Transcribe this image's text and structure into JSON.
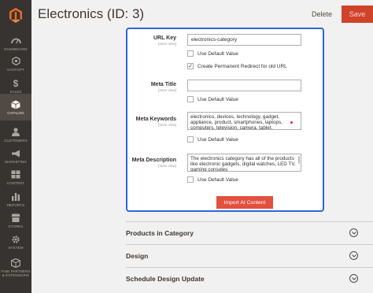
{
  "sidebar": {
    "items": [
      {
        "label": "Dashboard",
        "icon": "dashboard-icon"
      },
      {
        "label": "Chatgpt",
        "icon": "chatgpt-icon"
      },
      {
        "label": "Sales",
        "icon": "dollar-icon"
      },
      {
        "label": "Catalog",
        "icon": "catalog-icon"
      },
      {
        "label": "Customers",
        "icon": "customers-icon"
      },
      {
        "label": "Marketing",
        "icon": "megaphone-icon"
      },
      {
        "label": "Content",
        "icon": "content-icon"
      },
      {
        "label": "Reports",
        "icon": "bar-chart-icon"
      },
      {
        "label": "Stores",
        "icon": "stores-icon"
      },
      {
        "label": "System",
        "icon": "gear-icon"
      },
      {
        "label": "Find Partners & Extensions",
        "icon": "cube-icon"
      }
    ],
    "active_index": 3
  },
  "header": {
    "title": "Electronics (ID: 3)",
    "delete_label": "Delete",
    "save_label": "Save"
  },
  "form": {
    "store_view": "[store view]",
    "url_key": {
      "label": "URL Key",
      "value": "electronics-category",
      "use_default": "Use Default Value",
      "redirect": "Create Permanent Redirect for old URL"
    },
    "meta_title": {
      "label": "Meta Title",
      "value": "",
      "use_default": "Use Default Value"
    },
    "meta_keywords": {
      "label": "Meta Keywords",
      "value": "electronics, devices, technology, gadget, appliance, product, smartphones, laptops, computers, television, camera, tablet,",
      "use_default": "Use Default Value"
    },
    "meta_description": {
      "label": "Meta Description",
      "value": "The electronics category has all of the products like electronic gadgets, digital watches, LED TV, gaming consoles",
      "use_default": "Use Default Value"
    },
    "import_label": "Import AI Content"
  },
  "sections": [
    {
      "title": "Products in Category"
    },
    {
      "title": "Design"
    },
    {
      "title": "Schedule Design Update"
    }
  ],
  "colors": {
    "sidebar_bg": "#373330",
    "sidebar_active": "#514943",
    "save_bg": "#d0432a",
    "import_bg": "#e3503e",
    "panel_border": "#2f67d8"
  }
}
